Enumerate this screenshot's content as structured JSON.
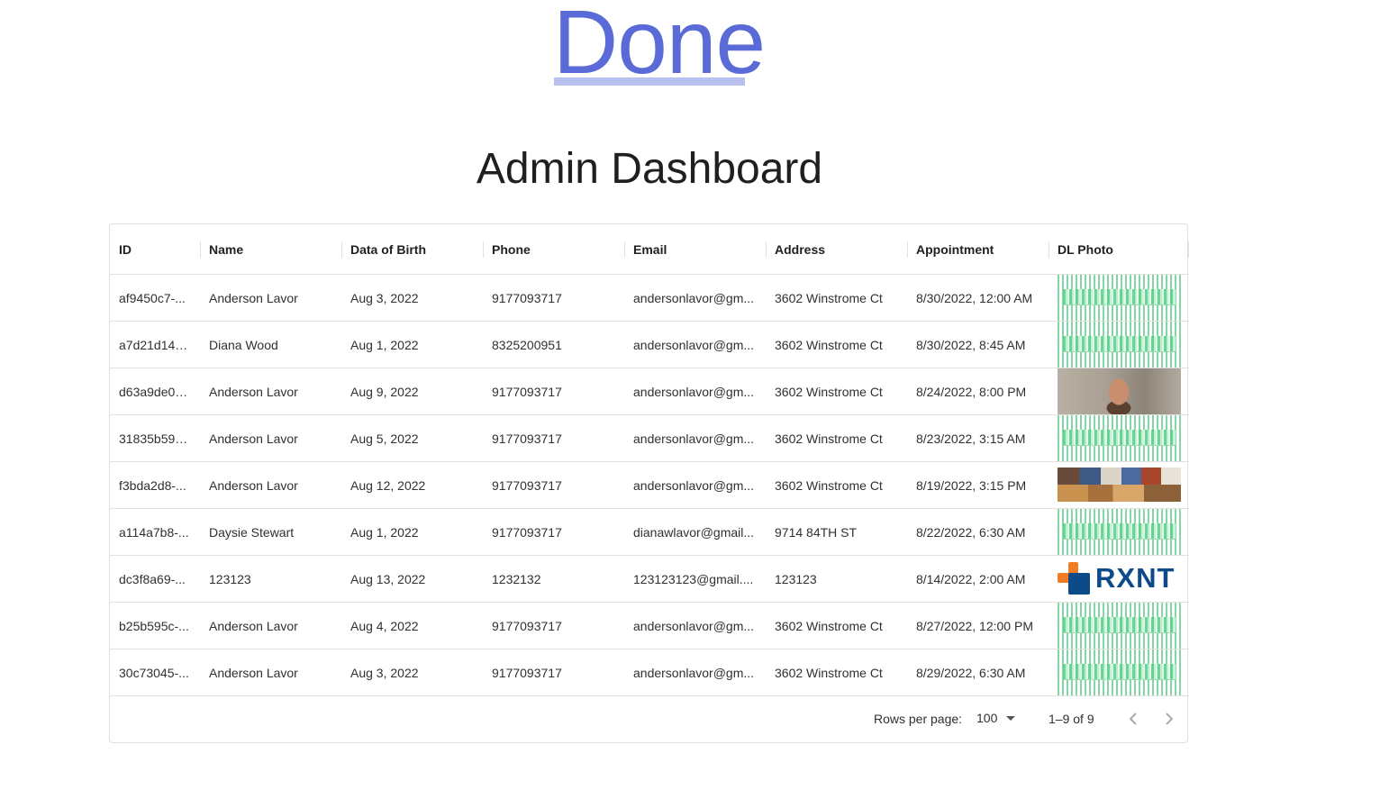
{
  "done_link": "Done",
  "page_title": "Admin Dashboard",
  "table": {
    "columns": [
      "ID",
      "Name",
      "Data of Birth",
      "Phone",
      "Email",
      "Address",
      "Appointment",
      "DL Photo"
    ],
    "rows": [
      {
        "id": "af9450c7-...",
        "name": "Anderson Lavor",
        "dob": "Aug 3, 2022",
        "phone": "9177093717",
        "email": "andersonlavor@gm...",
        "address": "3602 Winstrome Ct",
        "appointment": "8/30/2022, 12:00 AM",
        "photo": "chart-screenshot"
      },
      {
        "id": "a7d21d14-...",
        "name": "Diana Wood",
        "dob": "Aug 1, 2022",
        "phone": "8325200951",
        "email": "andersonlavor@gm...",
        "address": "3602 Winstrome Ct",
        "appointment": "8/30/2022, 8:45 AM",
        "photo": "chart-screenshot"
      },
      {
        "id": "d63a9de0-...",
        "name": "Anderson Lavor",
        "dob": "Aug 9, 2022",
        "phone": "9177093717",
        "email": "andersonlavor@gm...",
        "address": "3602 Winstrome Ct",
        "appointment": "8/24/2022, 8:00 PM",
        "photo": "face-photo"
      },
      {
        "id": "31835b59-...",
        "name": "Anderson Lavor",
        "dob": "Aug 5, 2022",
        "phone": "9177093717",
        "email": "andersonlavor@gm...",
        "address": "3602 Winstrome Ct",
        "appointment": "8/23/2022, 3:15 AM",
        "photo": "chart-screenshot"
      },
      {
        "id": "f3bda2d8-...",
        "name": "Anderson Lavor",
        "dob": "Aug 12, 2022",
        "phone": "9177093717",
        "email": "andersonlavor@gm...",
        "address": "3602 Winstrome Ct",
        "appointment": "8/19/2022, 3:15 PM",
        "photo": "collage-photo"
      },
      {
        "id": "a114a7b8-...",
        "name": "Daysie Stewart",
        "dob": "Aug 1, 2022",
        "phone": "9177093717",
        "email": "dianawlavor@gmail...",
        "address": "9714 84TH ST",
        "appointment": "8/22/2022, 6:30 AM",
        "photo": "chart-screenshot"
      },
      {
        "id": "dc3f8a69-...",
        "name": "123123",
        "dob": "Aug 13, 2022",
        "phone": "1232132",
        "email": "123123123@gmail....",
        "address": "123123",
        "appointment": "8/14/2022, 2:00 AM",
        "photo": "rxnt-logo"
      },
      {
        "id": "b25b595c-...",
        "name": "Anderson Lavor",
        "dob": "Aug 4, 2022",
        "phone": "9177093717",
        "email": "andersonlavor@gm...",
        "address": "3602 Winstrome Ct",
        "appointment": "8/27/2022, 12:00 PM",
        "photo": "chart-screenshot"
      },
      {
        "id": "30c73045-...",
        "name": "Anderson Lavor",
        "dob": "Aug 3, 2022",
        "phone": "9177093717",
        "email": "andersonlavor@gm...",
        "address": "3602 Winstrome Ct",
        "appointment": "8/29/2022, 6:30 AM",
        "photo": "chart-screenshot"
      }
    ],
    "logo_text": "RXNT"
  },
  "pagination": {
    "rows_per_page_label": "Rows per page:",
    "rows_per_page_value": "100",
    "range": "1–9 of 9",
    "prev_icon": "chevron-left-icon",
    "next_icon": "chevron-right-icon"
  }
}
